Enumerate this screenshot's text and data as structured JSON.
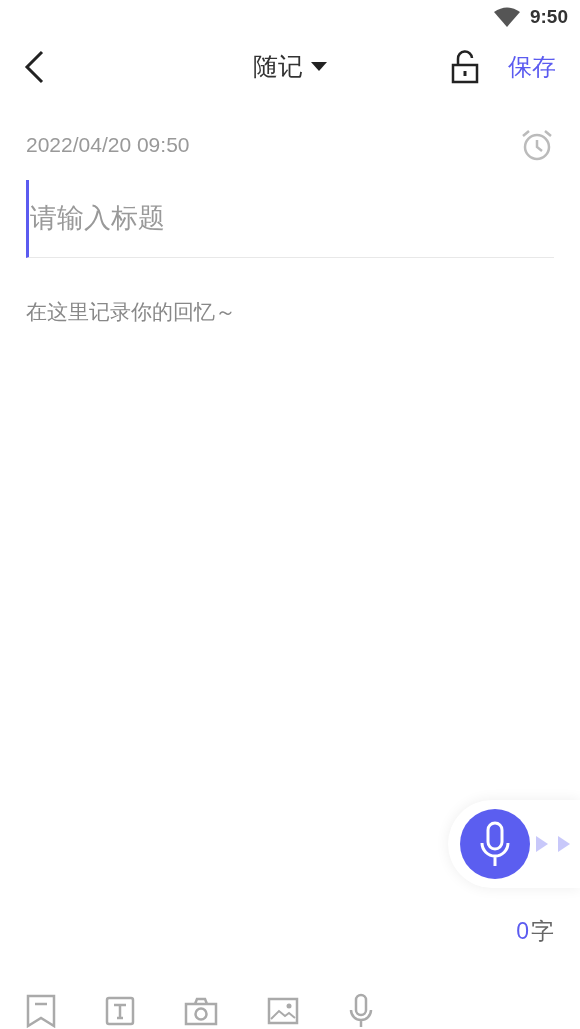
{
  "status_bar": {
    "time": "9:50"
  },
  "header": {
    "title": "随记",
    "save": "保存"
  },
  "note": {
    "date": "2022/04/20 09:50",
    "title_placeholder": "请输入标题",
    "body_placeholder": "在这里记录你的回忆～"
  },
  "word_count": {
    "count": "0",
    "unit": "字"
  }
}
